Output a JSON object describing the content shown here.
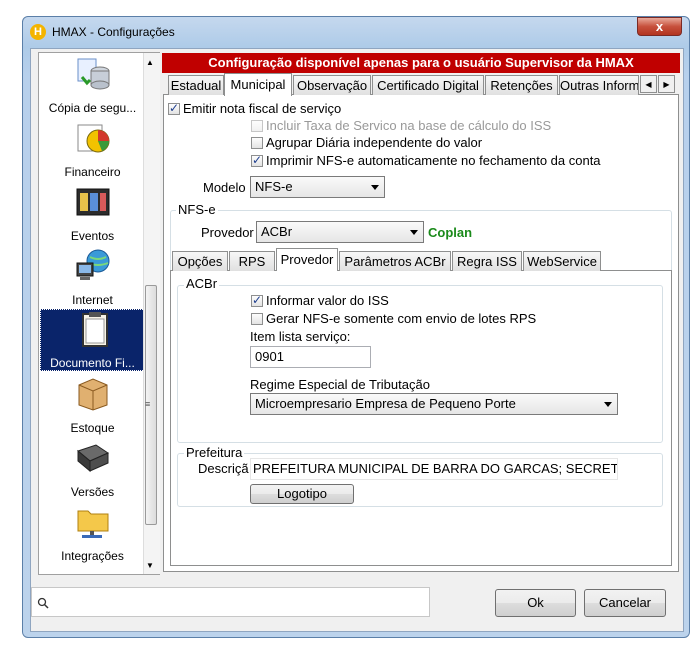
{
  "window": {
    "title": "HMAX - Configurações",
    "app_icon": "H",
    "close_label": "x"
  },
  "sidebar": {
    "items": [
      {
        "label": "Cópia de segu...",
        "icon": "backup-database-icon"
      },
      {
        "label": "Financeiro",
        "icon": "finance-chart-icon"
      },
      {
        "label": "Eventos",
        "icon": "calendar-icon"
      },
      {
        "label": "Internet",
        "icon": "network-computer-icon"
      },
      {
        "label": "Documento Fi...",
        "icon": "clipboard-icon",
        "selected": true
      },
      {
        "label": "Estoque",
        "icon": "box-icon"
      },
      {
        "label": "Versões",
        "icon": "chip-icon"
      },
      {
        "label": "Integrações",
        "icon": "folder-network-icon"
      }
    ]
  },
  "banner": "Configuração disponível apenas para o usuário Supervisor da HMAX",
  "tabs": [
    "Estadual",
    "Municipal",
    "Observação",
    "Certificado Digital",
    "Retenções",
    "Outras Inform"
  ],
  "municipal": {
    "emitir": "Emitir nota fiscal de serviço",
    "incluir_taxa": "Incluir Taxa de Servico na base de cálculo do ISS",
    "agrupar": "Agrupar Diária independente do valor",
    "imprimir": "Imprimir NFS-e automaticamente no fechamento da conta",
    "modelo_label": "Modelo",
    "modelo_value": "NFS-e"
  },
  "nfse": {
    "group_label": "NFS-e",
    "provedor_label": "Provedor",
    "provedor_value": "ACBr",
    "provedor_brand": "Coplan",
    "subtabs": [
      "Opções",
      "RPS",
      "Provedor",
      "Parâmetros ACBr",
      "Regra ISS",
      "WebService"
    ]
  },
  "acbr": {
    "group_label": "ACBr",
    "informar_iss": "Informar valor do ISS",
    "gerar_lotes": "Gerar NFS-e somente com envio de lotes RPS",
    "item_lista_label": "Item lista serviço:",
    "item_lista_value": "0901",
    "regime_label": "Regime Especial de Tributação",
    "regime_value": "Microempresario Empresa de Pequeno Porte"
  },
  "prefeitura": {
    "group_label": "Prefeitura",
    "descricao_label": "Descriçã",
    "descricao_value": "PREFEITURA MUNICIPAL DE BARRA DO GARCAS; SECRET",
    "logotipo_label": "Logotipo"
  },
  "footer": {
    "search_placeholder": "",
    "ok_label": "Ok",
    "cancel_label": "Cancelar"
  }
}
